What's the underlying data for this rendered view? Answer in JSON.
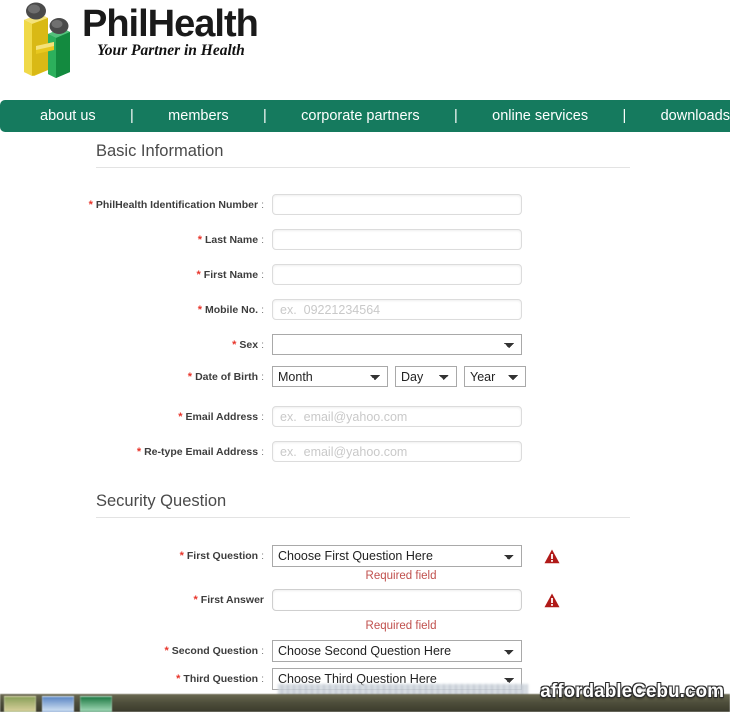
{
  "site": {
    "brand_name": "PhilHealth",
    "tagline": "Your Partner in Health",
    "logo_icon": "philhealth-two-figures-logo"
  },
  "nav": {
    "separator": "|",
    "items": [
      {
        "label": "about us"
      },
      {
        "label": "members"
      },
      {
        "label": "corporate partners"
      },
      {
        "label": "online services"
      },
      {
        "label": "downloads"
      }
    ]
  },
  "basic_information": {
    "heading": "Basic Information",
    "fields": {
      "pin": {
        "label": "PhilHealth Identification Number",
        "value": "",
        "placeholder": "",
        "required": true
      },
      "last_name": {
        "label": "Last Name",
        "value": "",
        "placeholder": "",
        "required": true
      },
      "first_name": {
        "label": "First Name",
        "value": "",
        "placeholder": "",
        "required": true
      },
      "mobile_no": {
        "label": "Mobile No.",
        "value": "",
        "placeholder": "ex.  09221234564",
        "required": true
      },
      "sex": {
        "label": "Sex",
        "selected": "",
        "required": true
      },
      "date_of_birth": {
        "label": "Date of Birth",
        "required": true,
        "month_selected": "Month",
        "day_selected": "Day",
        "year_selected": "Year"
      },
      "email": {
        "label": "Email Address",
        "value": "",
        "placeholder": "ex.  email@yahoo.com",
        "required": true
      },
      "retype_email": {
        "label": "Re-type Email Address",
        "value": "",
        "placeholder": "ex.  email@yahoo.com",
        "required": true
      }
    }
  },
  "security_question": {
    "heading": "Security Question",
    "fields": {
      "first_question": {
        "label": "First Question",
        "selected": "Choose First Question Here",
        "required": true,
        "error": "Required field",
        "has_warning": true
      },
      "first_answer": {
        "label": "First Answer",
        "value": "",
        "required": true,
        "error": "Required field",
        "has_warning": true
      },
      "second_question": {
        "label": "Second Question",
        "selected": "Choose Second Question Here",
        "required": true
      },
      "third_question": {
        "label": "Third Question",
        "selected": "Choose Third Question Here",
        "required": true
      }
    }
  },
  "colors": {
    "nav_green": "#157a5e",
    "required_star": "#e8342a",
    "error_text": "#c0504d",
    "warning_icon": "#b01a18"
  },
  "watermark": {
    "text": "affordableCebu.com"
  },
  "labels": {
    "colon": ":",
    "asterisk": "*"
  }
}
